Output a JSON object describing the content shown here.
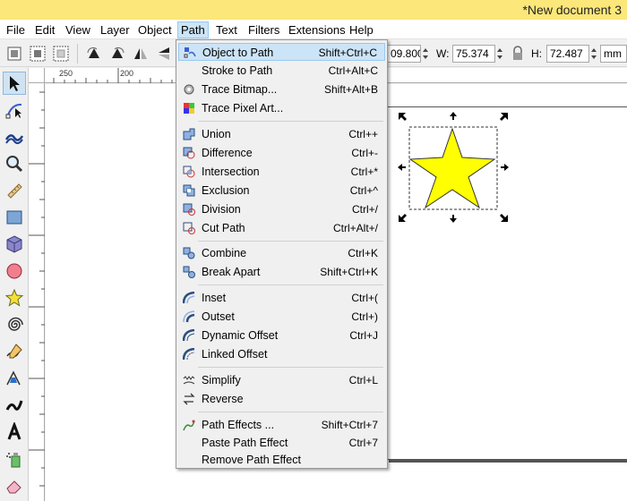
{
  "window": {
    "title": "*New document 3"
  },
  "menubar": {
    "items": [
      {
        "label": "File",
        "active": false
      },
      {
        "label": "Edit",
        "active": false
      },
      {
        "label": "View",
        "active": false
      },
      {
        "label": "Layer",
        "active": false
      },
      {
        "label": "Object",
        "active": false
      },
      {
        "label": "Path",
        "active": true
      },
      {
        "label": "Text",
        "active": false
      },
      {
        "label": "Filters",
        "active": false
      },
      {
        "label": "Extensions",
        "active": false
      },
      {
        "label": "Help",
        "active": false
      }
    ]
  },
  "toolbar": {
    "y_value": "09.800",
    "w_label": "W:",
    "w_value": "75.374",
    "h_label": "H:",
    "h_value": "72.487",
    "unit": "mm",
    "lock_icon": "lock-icon"
  },
  "ruler": {
    "top_labels": [
      "250",
      "200"
    ],
    "left_labels": [
      "",
      ""
    ]
  },
  "path_menu": {
    "groups": [
      [
        {
          "label": "Object to Path",
          "accel": "Shift+Ctrl+C",
          "icon": "object-to-path-icon",
          "highlight": true
        },
        {
          "label": "Stroke to Path",
          "accel": "Ctrl+Alt+C",
          "icon": "",
          "highlight": false
        },
        {
          "label": "Trace Bitmap...",
          "accel": "Shift+Alt+B",
          "icon": "trace-bitmap-icon",
          "highlight": false
        },
        {
          "label": "Trace Pixel Art...",
          "accel": "",
          "icon": "trace-pixel-art-icon",
          "highlight": false
        }
      ],
      [
        {
          "label": "Union",
          "accel": "Ctrl++",
          "icon": "union-icon",
          "highlight": false
        },
        {
          "label": "Difference",
          "accel": "Ctrl+-",
          "icon": "difference-icon",
          "highlight": false
        },
        {
          "label": "Intersection",
          "accel": "Ctrl+*",
          "icon": "intersection-icon",
          "highlight": false
        },
        {
          "label": "Exclusion",
          "accel": "Ctrl+^",
          "icon": "exclusion-icon",
          "highlight": false
        },
        {
          "label": "Division",
          "accel": "Ctrl+/",
          "icon": "division-icon",
          "highlight": false
        },
        {
          "label": "Cut Path",
          "accel": "Ctrl+Alt+/",
          "icon": "cut-path-icon",
          "highlight": false
        }
      ],
      [
        {
          "label": "Combine",
          "accel": "Ctrl+K",
          "icon": "combine-icon",
          "highlight": false
        },
        {
          "label": "Break Apart",
          "accel": "Shift+Ctrl+K",
          "icon": "break-apart-icon",
          "highlight": false
        }
      ],
      [
        {
          "label": "Inset",
          "accel": "Ctrl+(",
          "icon": "inset-icon",
          "highlight": false
        },
        {
          "label": "Outset",
          "accel": "Ctrl+)",
          "icon": "outset-icon",
          "highlight": false
        },
        {
          "label": "Dynamic Offset",
          "accel": "Ctrl+J",
          "icon": "dynamic-offset-icon",
          "highlight": false
        },
        {
          "label": "Linked Offset",
          "accel": "",
          "icon": "linked-offset-icon",
          "highlight": false
        }
      ],
      [
        {
          "label": "Simplify",
          "accel": "Ctrl+L",
          "icon": "simplify-icon",
          "highlight": false
        },
        {
          "label": "Reverse",
          "accel": "",
          "icon": "reverse-icon",
          "highlight": false
        }
      ],
      [
        {
          "label": "Path Effects ...",
          "accel": "Shift+Ctrl+7",
          "icon": "path-effects-icon",
          "highlight": false
        },
        {
          "label": "Paste Path Effect",
          "accel": "Ctrl+7",
          "icon": "",
          "highlight": false
        },
        {
          "label": "Remove Path Effect",
          "accel": "",
          "icon": "",
          "highlight": false
        }
      ]
    ]
  },
  "tools": [
    {
      "name": "selector-tool-icon",
      "active": true
    },
    {
      "name": "node-tool-icon",
      "active": false
    },
    {
      "name": "tweak-tool-icon",
      "active": false
    },
    {
      "name": "zoom-tool-icon",
      "active": false
    },
    {
      "name": "measure-tool-icon",
      "active": false
    },
    {
      "name": "rectangle-tool-icon",
      "active": false
    },
    {
      "name": "3d-box-tool-icon",
      "active": false
    },
    {
      "name": "ellipse-tool-icon",
      "active": false
    },
    {
      "name": "star-tool-icon",
      "active": false
    },
    {
      "name": "spiral-tool-icon",
      "active": false
    },
    {
      "name": "pencil-tool-icon",
      "active": false
    },
    {
      "name": "pen-tool-icon",
      "active": false
    },
    {
      "name": "calligraphy-tool-icon",
      "active": false
    },
    {
      "name": "text-tool-icon",
      "active": false
    },
    {
      "name": "spray-tool-icon",
      "active": false
    },
    {
      "name": "eraser-tool-icon",
      "active": false
    }
  ],
  "colors": {
    "title_bg": "#fbe77a",
    "star_fill": "#ffff00",
    "menu_highlight": "#cce4f7"
  }
}
